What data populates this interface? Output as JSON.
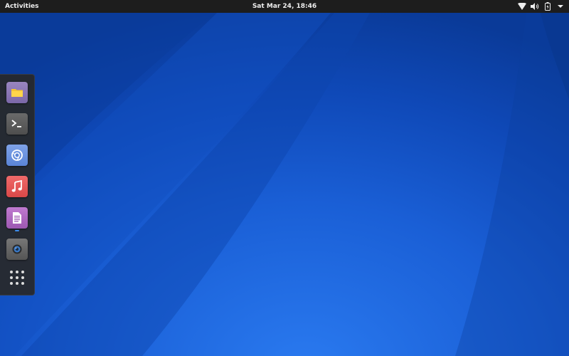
{
  "topbar": {
    "activities_label": "Activities",
    "clock_text": "Sat Mar 24, 18:46",
    "tray_icons": [
      "wifi-icon",
      "volume-icon",
      "battery-charging-icon",
      "menu-arrow-icon"
    ]
  },
  "dock": {
    "items": [
      {
        "name": "files-app-icon",
        "color": "#8a76b6"
      },
      {
        "name": "terminal-app-icon",
        "color": "#5a5a5a"
      },
      {
        "name": "chromium-app-icon",
        "color": "#6b92df"
      },
      {
        "name": "music-app-icon",
        "color": "#e35959"
      },
      {
        "name": "text-editor-app-icon",
        "color": "#ae68c2"
      },
      {
        "name": "webcam-app-icon",
        "color": "#666666"
      },
      {
        "name": "show-applications-icon",
        "color": "#ffffff"
      }
    ],
    "running_indicator_color": "#3d8ef0"
  },
  "wallpaper": {
    "base_color": "#1a5fd6",
    "highlight_color": "#2a7af0",
    "dark_color": "#0a3a98"
  }
}
